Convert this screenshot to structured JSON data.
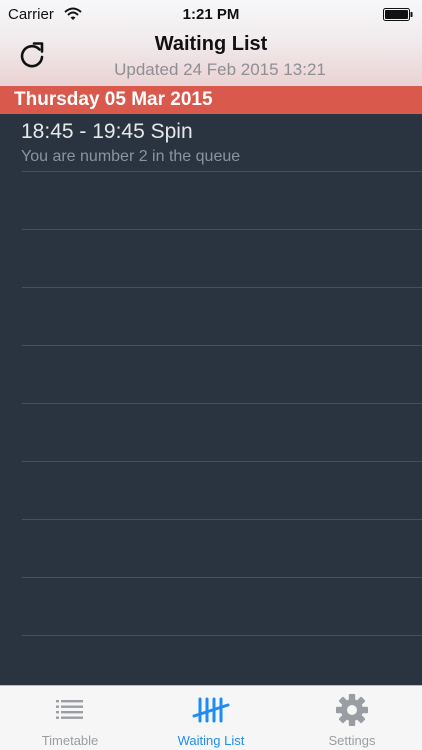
{
  "status_bar": {
    "carrier": "Carrier",
    "time": "1:21 PM"
  },
  "nav": {
    "title": "Waiting List",
    "subtitle": "Updated 24 Feb 2015 13:21",
    "refresh_icon": "refresh-icon"
  },
  "section": {
    "header": "Thursday 05 Mar 2015"
  },
  "rows": [
    {
      "title": "18:45 - 19:45 Spin",
      "subtitle": "You are number 2 in the queue"
    }
  ],
  "tabs": [
    {
      "label": "Timetable",
      "icon": "list-icon",
      "selected": false
    },
    {
      "label": "Waiting List",
      "icon": "tally-icon",
      "selected": true
    },
    {
      "label": "Settings",
      "icon": "gear-icon",
      "selected": false
    }
  ],
  "colors": {
    "accent": "#1e8cf0",
    "section_header": "#d9594d",
    "list_background": "#2a3440",
    "tab_inactive": "#9a9ea3"
  }
}
